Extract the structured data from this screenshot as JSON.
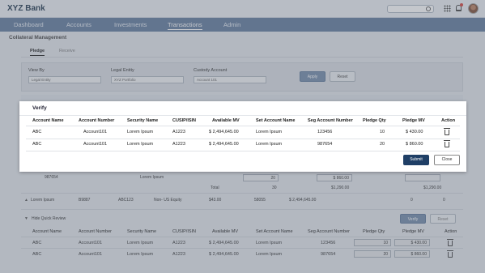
{
  "app": {
    "title": "XYZ Bank"
  },
  "nav": {
    "items": [
      "Dashboard",
      "Accounts",
      "Investments",
      "Transactions",
      "Admin"
    ],
    "active": "Transactions"
  },
  "page": {
    "title": "Collateral Management"
  },
  "subtabs": [
    "Pledge",
    "Receive"
  ],
  "filters": {
    "view_by": {
      "label": "View By",
      "value": "Legal Entity"
    },
    "legal_entity": {
      "label": "Legal Entity",
      "value": "XYZ Portfolio"
    },
    "custody_account": {
      "label": "Custody Account",
      "value": "Account 101"
    },
    "apply_label": "Apply",
    "reset_label": "Reset"
  },
  "background": {
    "row1": {
      "security": "987654",
      "name": "Lorem Ipsum",
      "qty": "20",
      "mv": "$ 860.00"
    },
    "total": {
      "label": "Total",
      "qty": "30",
      "mv1": "$1,290.00",
      "mv2": "$1,290.00"
    },
    "group_row": {
      "name": "Lorem Ipsum",
      "code": "B9887",
      "cusip": "ABC123",
      "type": "Non- US Equity",
      "price": "$43.00",
      "qty": "58055",
      "mv": "$ 2,494,645.00",
      "v1": "0",
      "v2": "0"
    },
    "quick_review": {
      "label": "Hide Quick Review",
      "verify_label": "Verify",
      "reset_label": "Reset"
    },
    "headers": [
      "Account Name",
      "Account Number",
      "Security Name",
      "CUSIP/ISIN",
      "Available MV",
      "Set Account Name",
      "Seg Account Number",
      "Pledge Qty",
      "Pledge MV",
      "Action"
    ],
    "rows": [
      [
        "ABC",
        "Account101",
        "Lorem Ipsum",
        "A1223",
        "$ 2,494,645.00",
        "Lorem Ipsum",
        "123456",
        "10",
        "$ 430.00"
      ],
      [
        "ABC",
        "Account101",
        "Lorem Ipsum",
        "A1223",
        "$ 2,494,645.00",
        "Lorem Ipsum",
        "987654",
        "20",
        "$ 860.00"
      ]
    ]
  },
  "modal": {
    "title": "Verify",
    "headers": [
      "Account Name",
      "Account Number",
      "Security Name",
      "CUSIP/ISIN",
      "Available MV",
      "Set Account Name",
      "Seg Account Number",
      "Pledge Qty",
      "Pledge MV",
      "Action"
    ],
    "rows": [
      [
        "ABC",
        "Account101",
        "Lorem Ipsum",
        "A1223",
        "$ 2,494,645.00",
        "Lorem Ipsum",
        "123456",
        "10",
        "$ 430.00"
      ],
      [
        "ABC",
        "Account101",
        "Lorem Ipsum",
        "A1223",
        "$ 2,494,645.00",
        "Lorem Ipsum",
        "987654",
        "20",
        "$ 860.00"
      ]
    ],
    "submit_label": "Submit",
    "close_label": "Close"
  },
  "colors": {
    "nav": "#6f87a6",
    "primary": "#1f3f66",
    "accent": "#7f96b2"
  },
  "icons": [
    "search-icon",
    "apps-grid-icon",
    "bell-icon",
    "trash-icon",
    "chevron-up-icon"
  ]
}
